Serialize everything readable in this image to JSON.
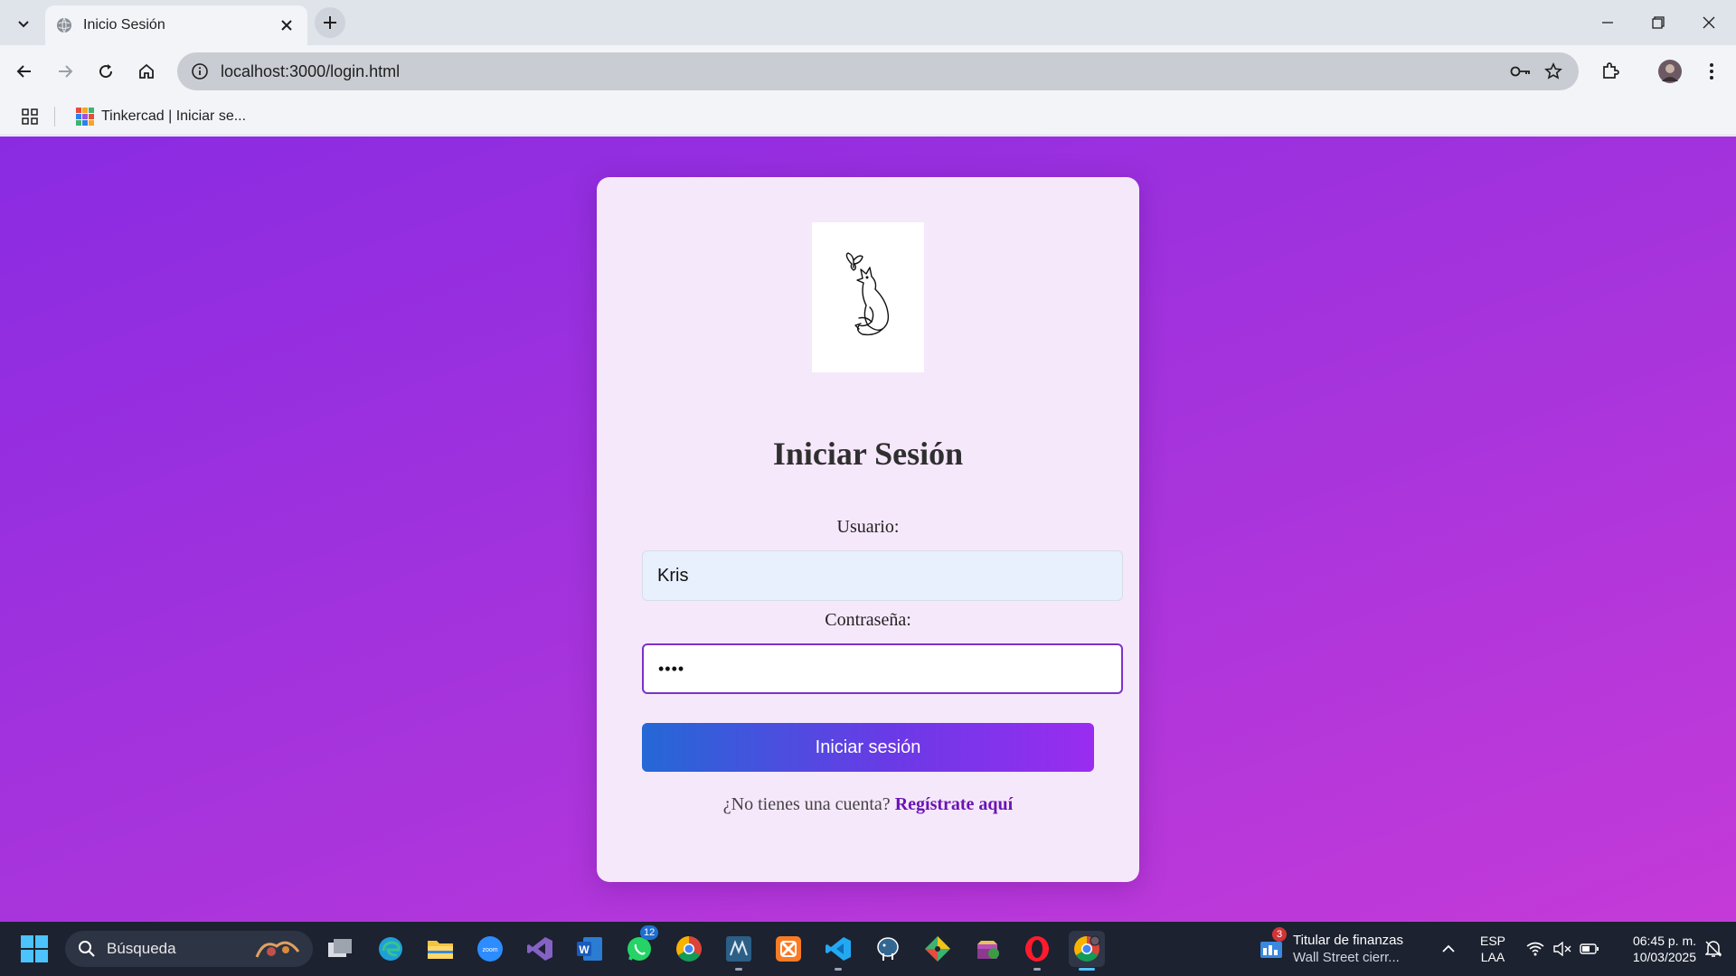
{
  "browser": {
    "tab_title": "Inicio Sesión",
    "url": "localhost:3000/login.html",
    "bookmarks": [
      {
        "label": "Tinkercad | Iniciar se..."
      }
    ]
  },
  "login": {
    "heading": "Iniciar Sesión",
    "username_label": "Usuario:",
    "username_value": "Kris",
    "password_label": "Contraseña:",
    "password_value": "••••",
    "submit_label": "Iniciar sesión",
    "register_prompt": "¿No tienes una cuenta?",
    "register_link": "Regístrate aquí"
  },
  "taskbar": {
    "search_placeholder": "Búsqueda",
    "whatsapp_badge": "12",
    "news_badge": "3",
    "news_title": "Titular de finanzas",
    "news_subtitle": "Wall Street cierr...",
    "language_top": "ESP",
    "language_bottom": "LAA",
    "time": "06:45 p. m.",
    "date": "10/03/2025"
  },
  "colors": {
    "page_gradient_start": "#8a2be2",
    "page_gradient_end": "#c43ad8",
    "card_background": "#f6e8fb",
    "button_gradient_start": "#2468d6",
    "button_gradient_end": "#9a2cf0",
    "link_color": "#6a14b4"
  }
}
